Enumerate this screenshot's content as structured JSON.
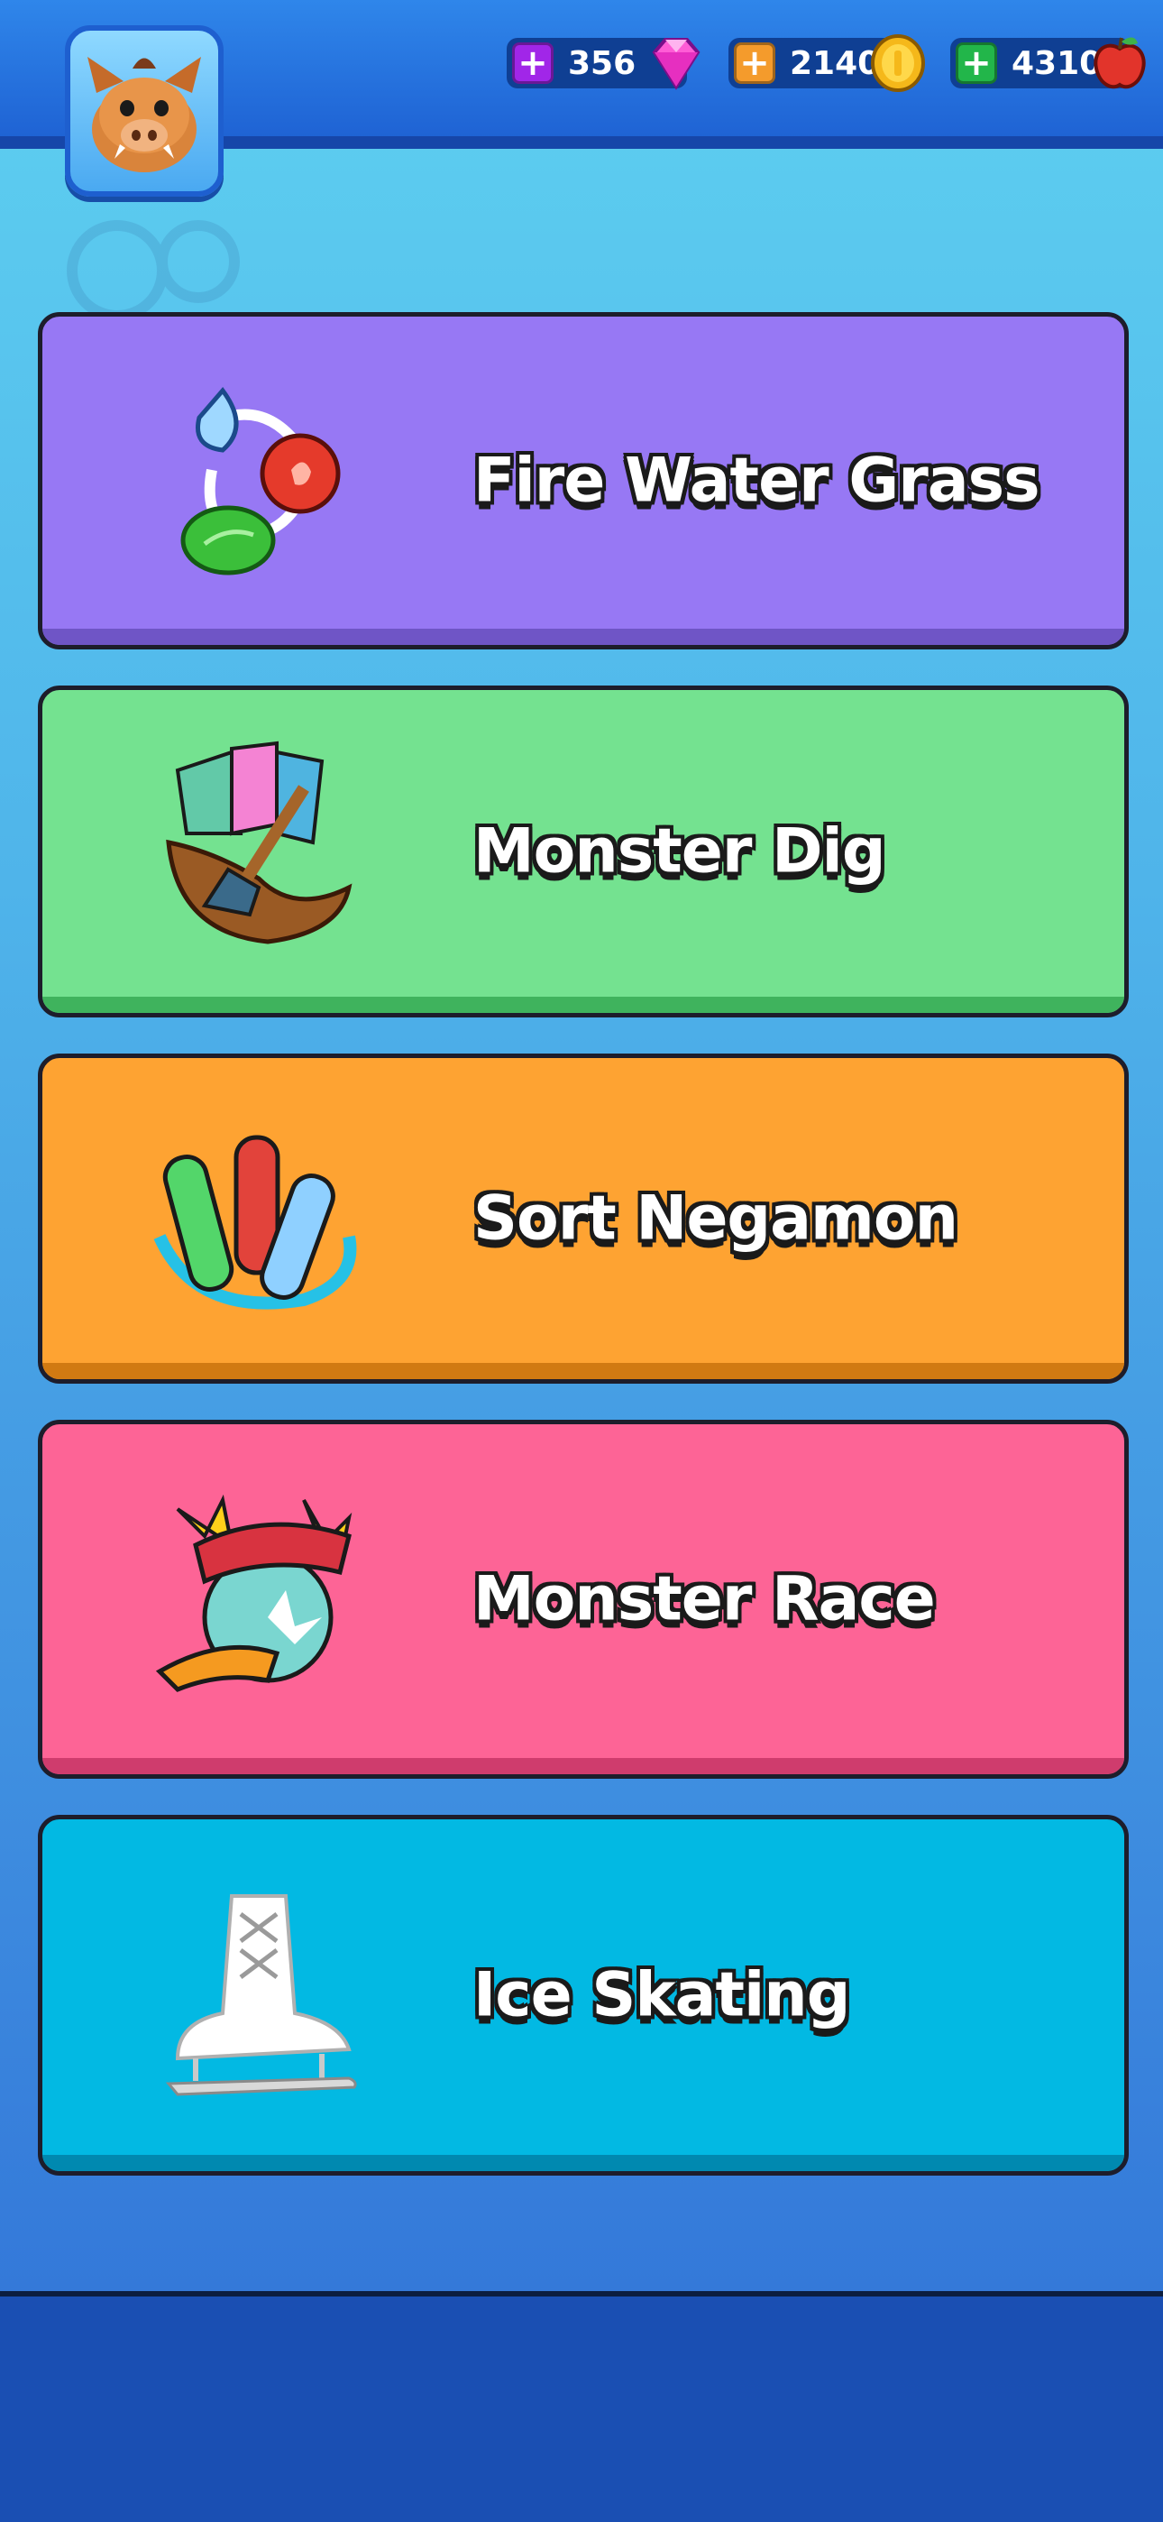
{
  "header": {
    "currencies": [
      {
        "name": "gems",
        "value": "356",
        "plus_color": "#a126e8",
        "icon": "gem-icon"
      },
      {
        "name": "coins",
        "value": "2140",
        "plus_color": "#f49b2c",
        "icon": "coin-icon"
      },
      {
        "name": "apples",
        "value": "4310",
        "plus_color": "#22b64a",
        "icon": "apple-icon"
      }
    ],
    "avatar_icon": "boar-avatar-icon"
  },
  "games": [
    {
      "label": "Fire Water Grass",
      "color": "#9778f4",
      "shade": "#6f55c6",
      "icon": "fire-water-grass-cycle-icon"
    },
    {
      "label": "Monster Dig",
      "color": "#74e290",
      "shade": "#3fb35d",
      "icon": "shovel-dig-icon"
    },
    {
      "label": "Sort Negamon",
      "color": "#fea332",
      "shade": "#d17a12",
      "icon": "test-tubes-icon"
    },
    {
      "label": "Monster Race",
      "color": "#fd6496",
      "shade": "#cf3c6d",
      "icon": "race-wheel-icon"
    },
    {
      "label": "Ice Skating",
      "color": "#02b9e3",
      "shade": "#0089b0",
      "icon": "ice-skate-icon"
    }
  ]
}
